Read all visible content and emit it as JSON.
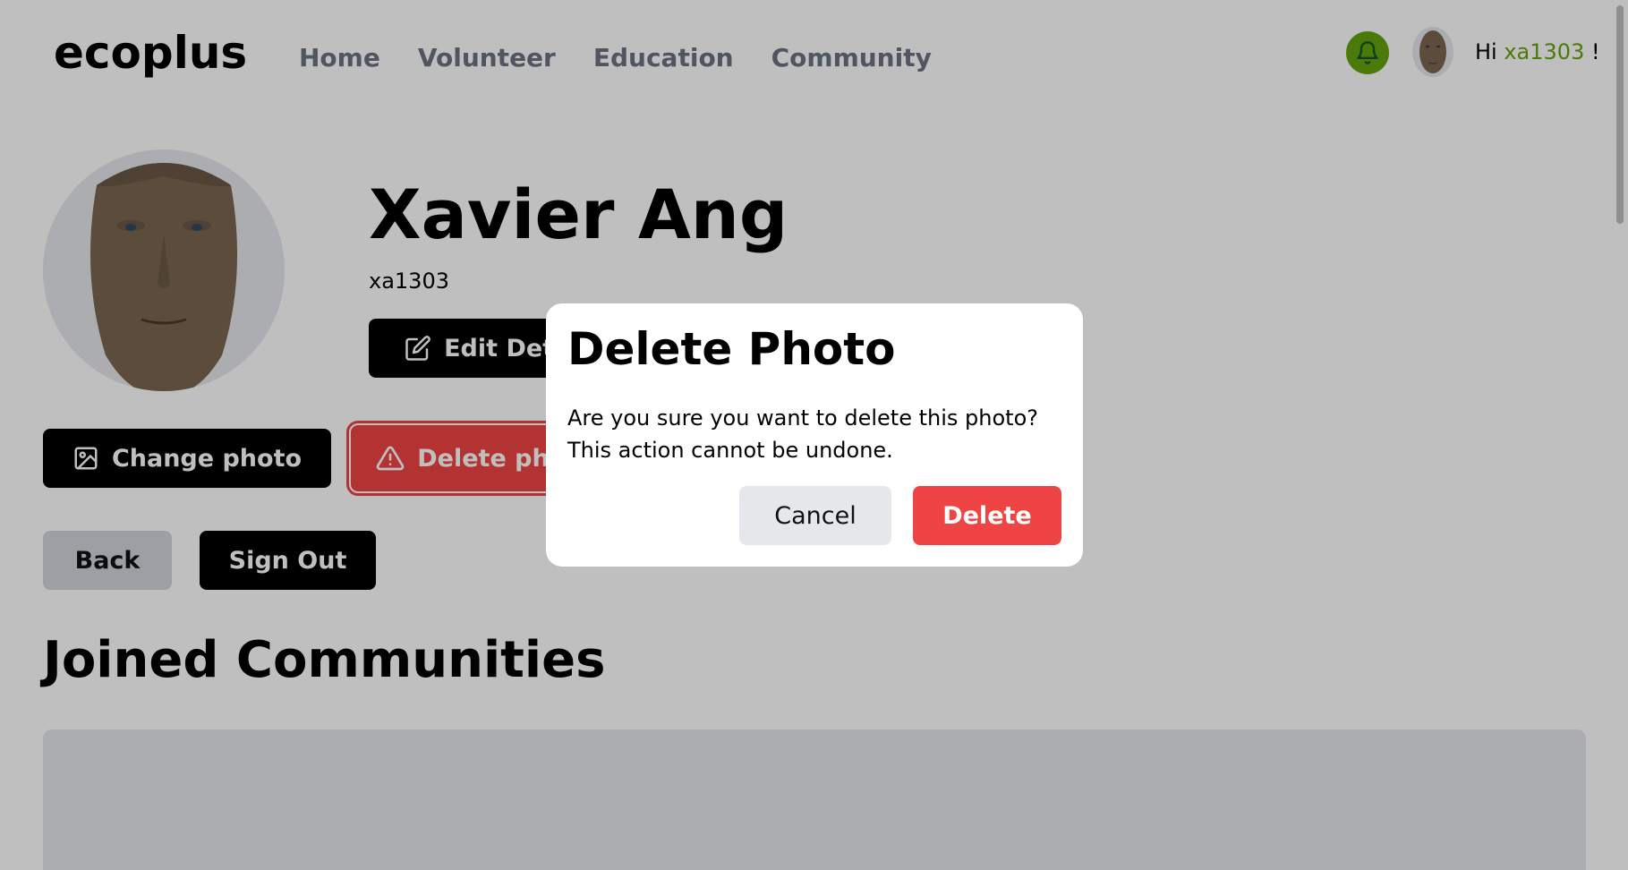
{
  "header": {
    "logo": "ecoplus",
    "nav": [
      {
        "label": "Home"
      },
      {
        "label": "Volunteer"
      },
      {
        "label": "Education"
      },
      {
        "label": "Community"
      }
    ],
    "greeting_prefix": "Hi ",
    "greeting_user": "xa1303",
    "greeting_suffix": " !"
  },
  "profile": {
    "name": "Xavier Ang",
    "username": "xa1303",
    "edit_label": "Edit Details",
    "change_photo_label": "Change photo",
    "delete_photo_label": "Delete photo",
    "back_label": "Back",
    "signout_label": "Sign Out"
  },
  "communities": {
    "title": "Joined Communities"
  },
  "modal": {
    "title": "Delete Photo",
    "message": "Are you sure you want to delete this photo? This action cannot be undone.",
    "cancel_label": "Cancel",
    "delete_label": "Delete"
  },
  "colors": {
    "brand_green": "#65a30d",
    "danger_red": "#ef4444",
    "nav_gray": "#6b7280"
  }
}
